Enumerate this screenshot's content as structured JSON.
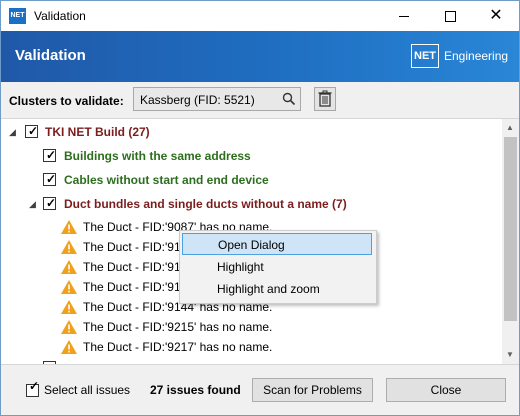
{
  "window": {
    "title": "Validation",
    "app_icon_text": "NET"
  },
  "header": {
    "title": "Validation",
    "brand_box": "NET",
    "brand_text": "Engineering"
  },
  "cluster": {
    "label": "Clusters to validate:",
    "value": "Kassberg (FID: 5521)"
  },
  "tree": {
    "root": "TKI NET Build (27)",
    "categories": [
      "Buildings with the same address",
      "Cables without start and end device",
      "Duct bundles and single ducts without a name (7)"
    ],
    "issues": [
      "The Duct - FID:'9087' has no name.",
      "The Duct - FID:'91",
      "The Duct - FID:'91",
      "The Duct - FID:'91",
      "The Duct - FID:'9144' has no name.",
      "The Duct - FID:'9215' has no name.",
      "The Duct - FID:'9217' has no name."
    ]
  },
  "context_menu": {
    "items": [
      "Open Dialog",
      "Highlight",
      "Highlight and zoom"
    ]
  },
  "footer": {
    "select_all": "Select all issues",
    "issues_found": "27 issues found",
    "scan_button": "Scan for Problems",
    "close_button": "Close"
  },
  "colors": {
    "banner": "#1f6fc2",
    "root_label": "#7b1d1d",
    "category_label": "#2c6e1d",
    "warning": "#f0a01a"
  }
}
